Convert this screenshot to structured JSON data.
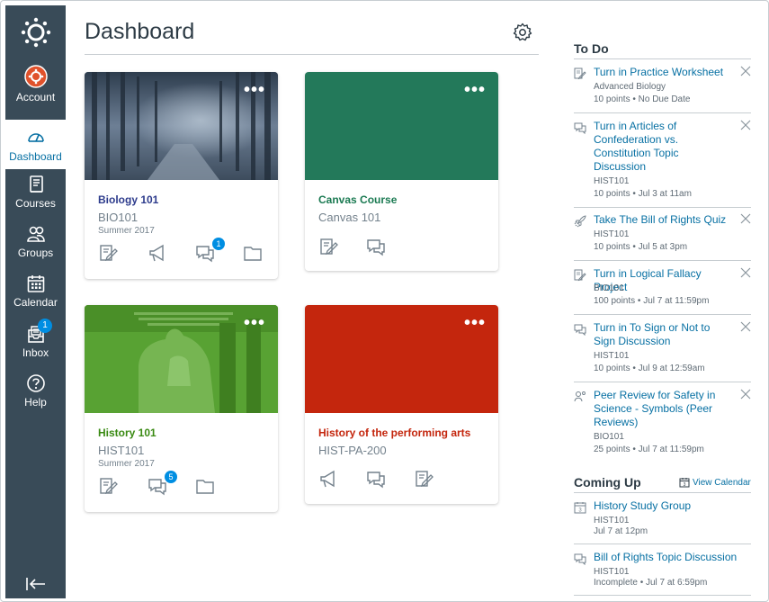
{
  "nav": {
    "account": "Account",
    "dashboard": "Dashboard",
    "courses": "Courses",
    "groups": "Groups",
    "calendar": "Calendar",
    "inbox": "Inbox",
    "inbox_badge": "1",
    "help": "Help"
  },
  "header": {
    "title": "Dashboard"
  },
  "cards": [
    {
      "title": "Biology 101",
      "code": "BIO101",
      "term": "Summer 2017",
      "color": "#2d3b8c",
      "discussion_badge": "1"
    },
    {
      "title": "Canvas Course",
      "code": "Canvas 101",
      "term": "",
      "color": "#1b7a52"
    },
    {
      "title": "History 101",
      "code": "HIST101",
      "term": "Summer 2017",
      "color": "#3a8a13",
      "discussion_badge": "5"
    },
    {
      "title": "History of the performing arts",
      "code": "HIST-PA-200",
      "term": "",
      "color": "#c4260d"
    }
  ],
  "todo": {
    "heading": "To Do",
    "items": [
      {
        "icon": "assignment-icon",
        "title": "Turn in Practice Worksheet",
        "course": "Advanced Biology",
        "meta": "10 points • No Due Date"
      },
      {
        "icon": "discussion-icon",
        "title": "Turn in Articles of Confederation vs. Constitution Topic Discussion",
        "course": "HIST101",
        "meta": "10 points • Jul 3 at 11am"
      },
      {
        "icon": "quiz-icon",
        "title": "Take The Bill of Rights Quiz",
        "course": "HIST101",
        "meta": "10 points • Jul 5 at 3pm"
      },
      {
        "icon": "assignment-icon",
        "title": "Turn in Logical Fallacy Project",
        "course": "BIO101",
        "meta": "100 points • Jul 7 at 11:59pm"
      },
      {
        "icon": "discussion-icon",
        "title": "Turn in To Sign or Not to Sign Discussion",
        "course": "HIST101",
        "meta": "10 points • Jul 9 at 12:59am"
      },
      {
        "icon": "peer-review-icon",
        "title": "Peer Review for Safety in Science - Symbols (Peer Reviews)",
        "course": "BIO101",
        "meta": "25 points • Jul 7 at 11:59pm"
      }
    ]
  },
  "coming_up": {
    "heading": "Coming Up",
    "view_calendar": "View Calendar",
    "items": [
      {
        "icon": "calendar-event-icon",
        "title": "History Study Group",
        "course": "HIST101",
        "meta": "Jul 7 at 12pm"
      },
      {
        "icon": "discussion-icon",
        "title": "Bill of Rights Topic Discussion",
        "course": "HIST101",
        "meta": "Incomplete • Jul 7 at 6:59pm"
      }
    ]
  }
}
